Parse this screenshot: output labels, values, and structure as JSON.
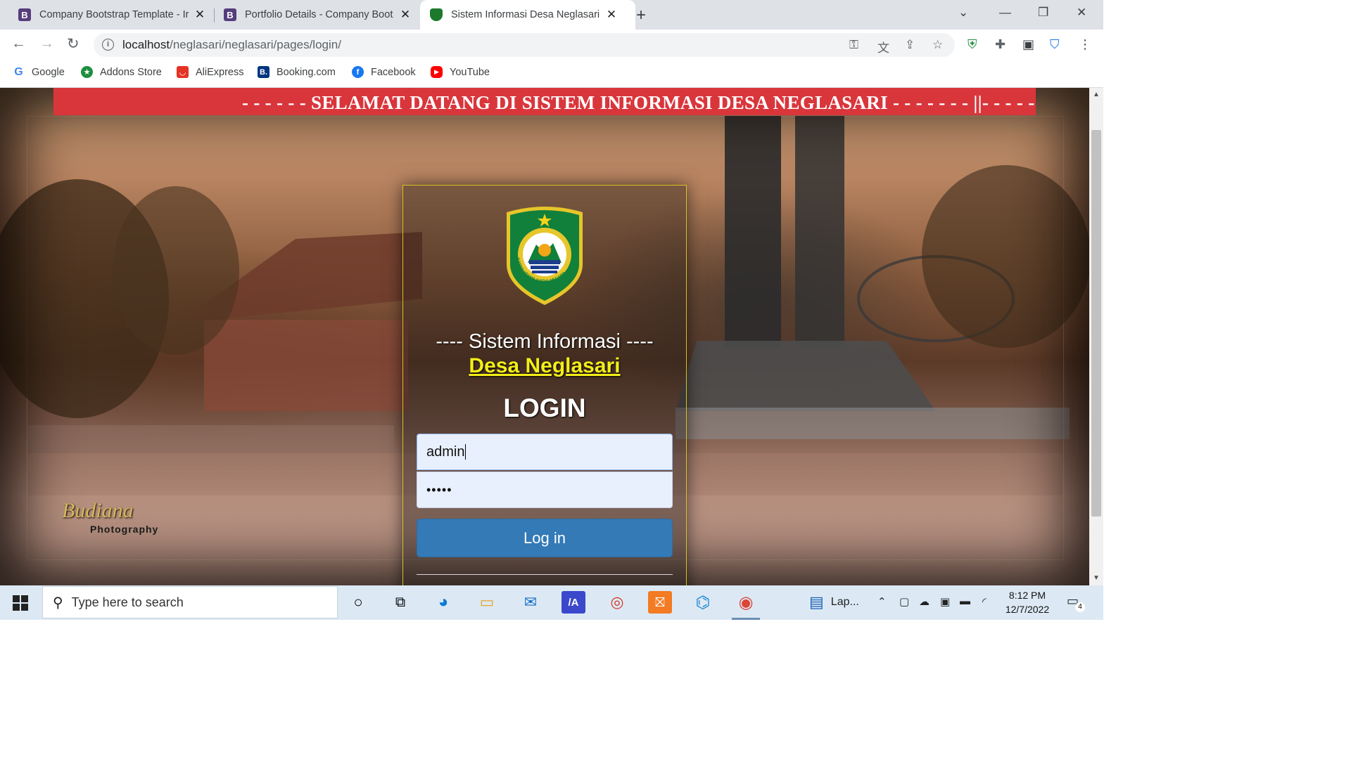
{
  "browser": {
    "tabs": [
      {
        "favicon": "B",
        "title": "Company Bootstrap Template - Ir"
      },
      {
        "favicon": "B",
        "title": "Portfolio Details - Company Boot"
      },
      {
        "favicon": "emblem",
        "title": "Sistem Informasi Desa Neglasari"
      }
    ],
    "active_tab": 2,
    "url_host": "localhost",
    "url_path": "/neglasari/neglasari/pages/login/",
    "bookmarks": [
      {
        "label": "Google",
        "icon": "google-icon",
        "color": "#4285f4"
      },
      {
        "label": "Addons Store",
        "icon": "addons-store-icon",
        "color": "#1e8e3e"
      },
      {
        "label": "AliExpress",
        "icon": "aliexpress-icon",
        "color": "#e43225"
      },
      {
        "label": "Booking.com",
        "icon": "booking-icon",
        "color": "#003580"
      },
      {
        "label": "Facebook",
        "icon": "facebook-icon",
        "color": "#1877f2"
      },
      {
        "label": "YouTube",
        "icon": "youtube-icon",
        "color": "#ff0000"
      }
    ]
  },
  "page": {
    "marquee_text": "- - - - - - SELAMAT DATANG DI SISTEM INFORMASI DESA NEGLASARI - - - - - - - ||- - - - - I",
    "watermark_script": "Budiana",
    "watermark_label": "Photography",
    "emblem": {
      "top_text": "BENTENG PANCASILA",
      "bottom_text": "KARYA UTAMA SATYA NEGARA"
    },
    "login": {
      "heading_line1": "---- Sistem Informasi ----",
      "heading_line2": "Desa Neglasari",
      "title": "LOGIN",
      "username_value": "admin",
      "password_value": "•••••",
      "submit_label": "Log in"
    }
  },
  "taskbar": {
    "search_placeholder": "Type here to search",
    "pinned_label": "Lap...",
    "time": "8:12 PM",
    "date": "12/7/2022",
    "notification_count": "4"
  },
  "colors": {
    "marquee_bg": "#d9363c",
    "accent_yellow": "#f2ee17",
    "login_button": "#337ab7"
  }
}
